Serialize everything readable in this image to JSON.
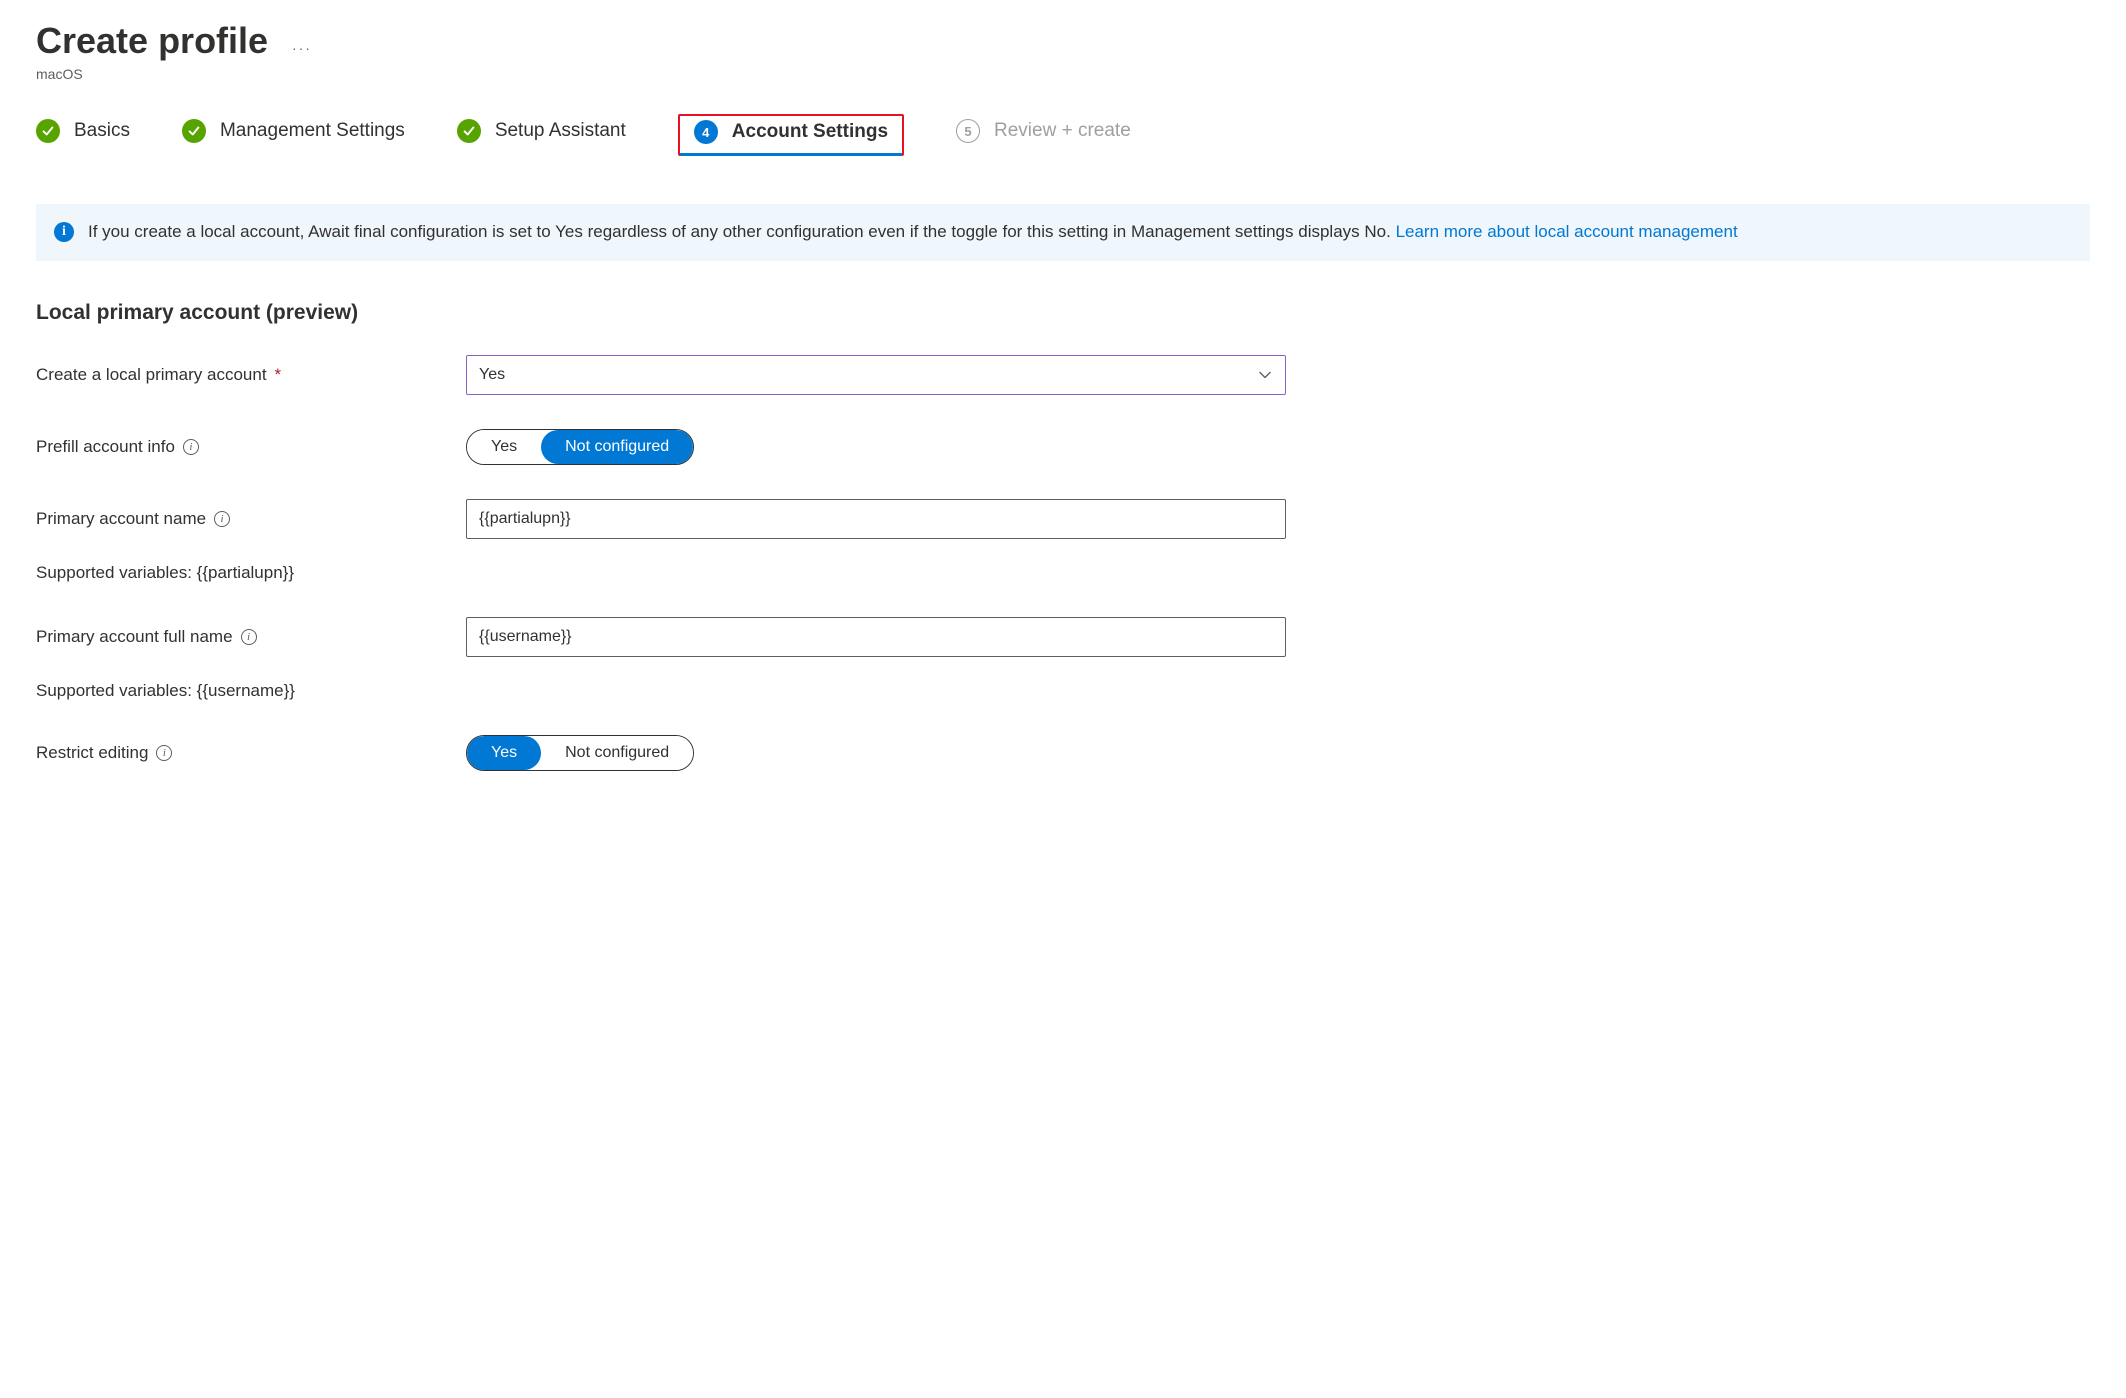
{
  "header": {
    "title": "Create profile",
    "ellipsis": "···",
    "subtitle": "macOS"
  },
  "stepper": {
    "steps": [
      {
        "label": "Basics",
        "state": "done"
      },
      {
        "label": "Management Settings",
        "state": "done"
      },
      {
        "label": "Setup Assistant",
        "state": "done"
      },
      {
        "label": "Account Settings",
        "state": "active",
        "number": "4"
      },
      {
        "label": "Review + create",
        "state": "disabled",
        "number": "5"
      }
    ]
  },
  "info_banner": {
    "text_prefix": "If you create a local account, Await final configuration is set to Yes regardless of any other configuration even if the toggle for this setting in Management settings displays No. ",
    "link_text": "Learn more about local account management"
  },
  "section": {
    "heading": "Local primary account (preview)"
  },
  "form": {
    "create_account": {
      "label": "Create a local primary account",
      "value": "Yes"
    },
    "prefill": {
      "label": "Prefill account info",
      "option_yes": "Yes",
      "option_no": "Not configured",
      "selected": "no"
    },
    "account_name": {
      "label": "Primary account name",
      "value": "{{partialupn}}",
      "support": "Supported variables: {{partialupn}}"
    },
    "full_name": {
      "label": "Primary account full name",
      "value": "{{username}}",
      "support": "Supported variables: {{username}}"
    },
    "restrict": {
      "label": "Restrict editing",
      "option_yes": "Yes",
      "option_no": "Not configured",
      "selected": "yes"
    }
  }
}
